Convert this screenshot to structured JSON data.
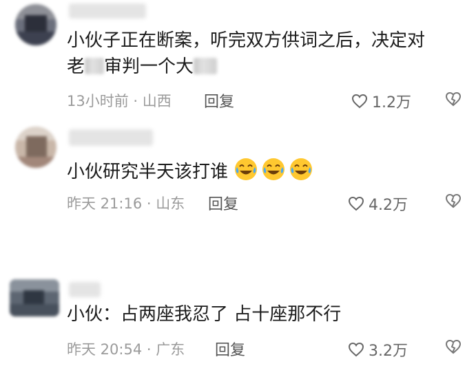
{
  "comments": [
    {
      "text_line1": "小伙子正在断案，听完双方供词之后，决定对",
      "text_line2_a": "老",
      "text_line2_b": "审判一个大",
      "meta": "13小时前 · 山西",
      "reply_label": "回复",
      "likes": "1.2万"
    },
    {
      "text": "小伙研究半天该打谁",
      "emojis": [
        "crying-laughing-emoji",
        "crying-laughing-emoji",
        "crying-laughing-emoji"
      ],
      "meta": "昨天 21:16 · 山东",
      "reply_label": "回复",
      "likes": "4.2万"
    },
    {
      "text": "小伙：占两座我忍了 占十座那不行",
      "meta": "昨天 20:54 · 广东",
      "reply_label": "回复",
      "likes": "3.2万"
    }
  ],
  "colors": {
    "text": "#1b1b1b",
    "meta": "#9a9a9a",
    "icon": "#666666"
  },
  "icons": [
    "heart-outline-icon",
    "broken-heart-icon",
    "crying-laughing-emoji"
  ]
}
